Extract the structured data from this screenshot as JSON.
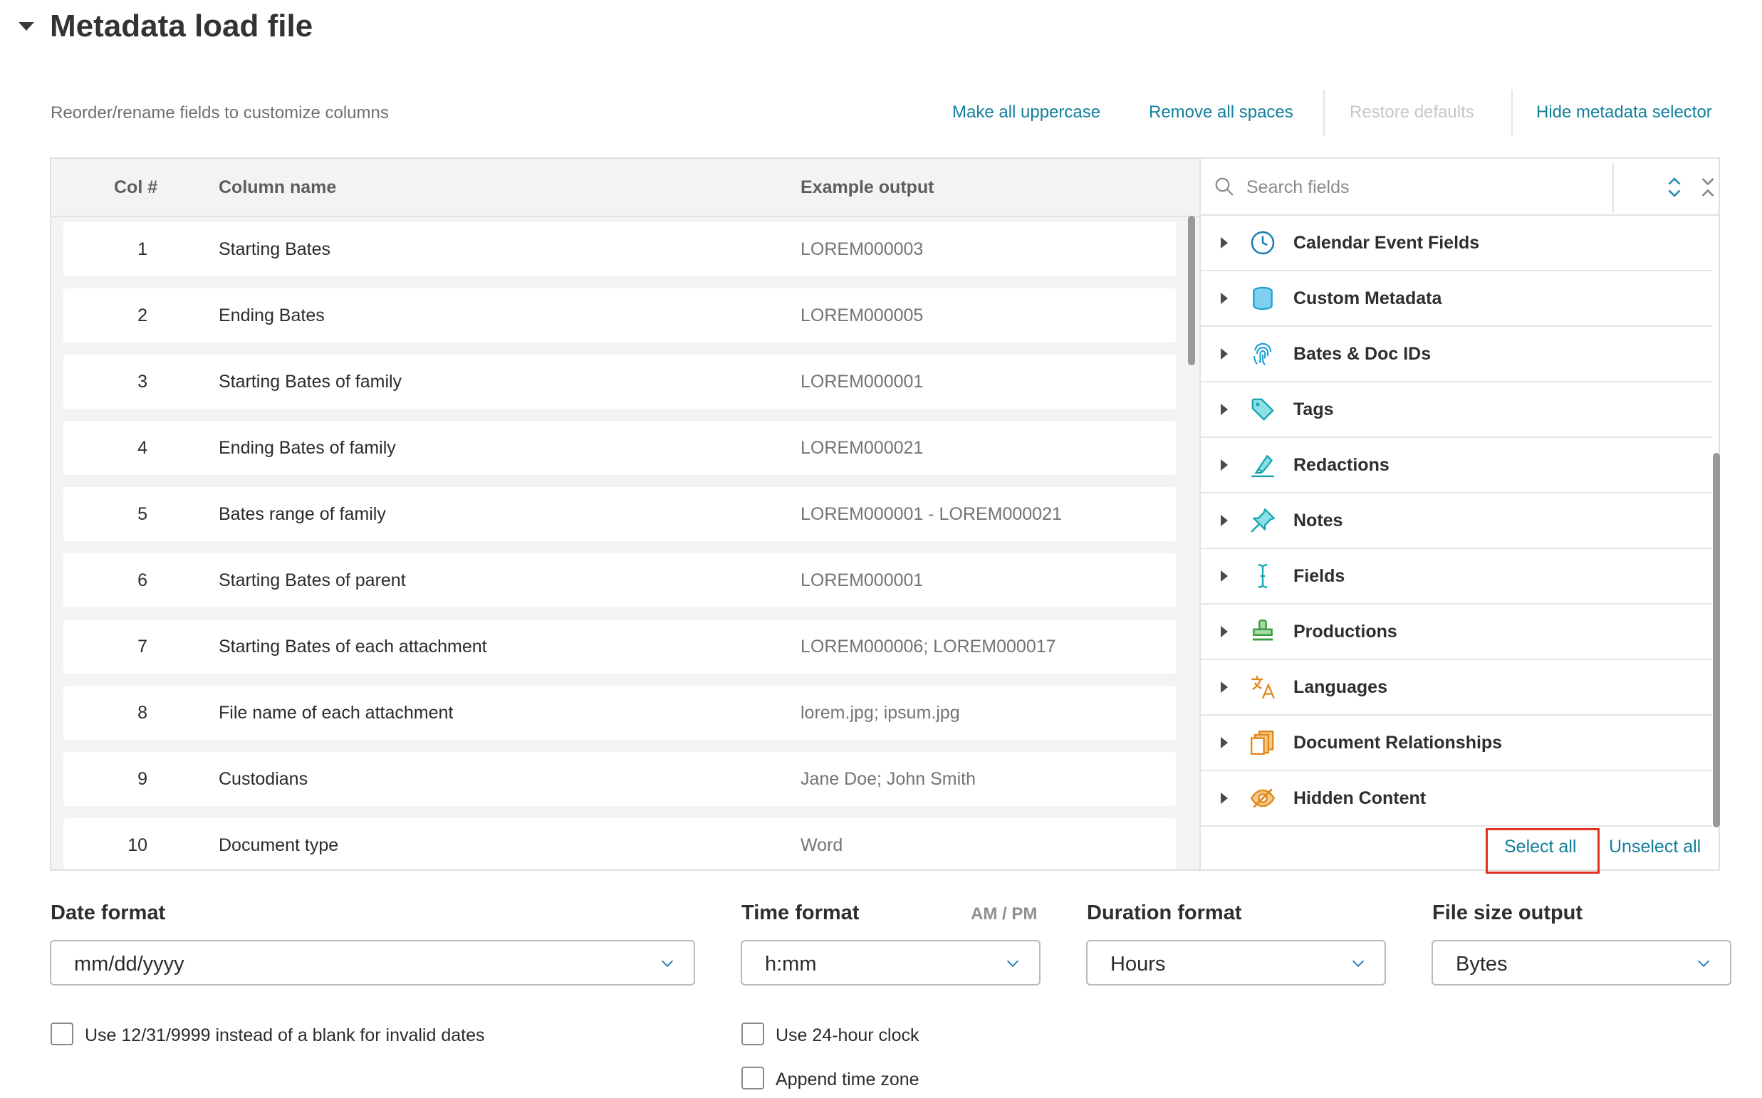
{
  "section": {
    "title": "Metadata load file"
  },
  "subtitle": "Reorder/rename fields to customize columns",
  "toolbar": {
    "uppercase": "Make all uppercase",
    "remove_spaces": "Remove all spaces",
    "restore": "Restore defaults",
    "hide_selector": "Hide metadata selector"
  },
  "table": {
    "headers": {
      "col": "Col #",
      "name": "Column name",
      "example": "Example output"
    },
    "rows": [
      {
        "num": "1",
        "name": "Starting Bates",
        "example": "LOREM000003"
      },
      {
        "num": "2",
        "name": "Ending Bates",
        "example": "LOREM000005"
      },
      {
        "num": "3",
        "name": "Starting Bates of family",
        "example": "LOREM000001"
      },
      {
        "num": "4",
        "name": "Ending Bates of family",
        "example": "LOREM000021"
      },
      {
        "num": "5",
        "name": "Bates range of family",
        "example": "LOREM000001 - LOREM000021"
      },
      {
        "num": "6",
        "name": "Starting Bates of parent",
        "example": "LOREM000001"
      },
      {
        "num": "7",
        "name": "Starting Bates of each attachment",
        "example": "LOREM000006; LOREM000017"
      },
      {
        "num": "8",
        "name": "File name of each attachment",
        "example": "lorem.jpg; ipsum.jpg"
      },
      {
        "num": "9",
        "name": "Custodians",
        "example": "Jane Doe; John Smith"
      },
      {
        "num": "10",
        "name": "Document type",
        "example": "Word"
      }
    ]
  },
  "selector": {
    "search_placeholder": "Search fields",
    "categories": [
      {
        "label": "Calendar Event Fields",
        "icon": "clock-icon",
        "color": "#1b7fb3"
      },
      {
        "label": "Custom Metadata",
        "icon": "database-icon",
        "color": "#21a1d6"
      },
      {
        "label": "Bates & Doc IDs",
        "icon": "fingerprint-icon",
        "color": "#21a1d6"
      },
      {
        "label": "Tags",
        "icon": "tag-icon",
        "color": "#16a6b3"
      },
      {
        "label": "Redactions",
        "icon": "marker-icon",
        "color": "#16a6b3"
      },
      {
        "label": "Notes",
        "icon": "pushpin-icon",
        "color": "#16a6b3"
      },
      {
        "label": "Fields",
        "icon": "text-cursor-icon",
        "color": "#16a6b3"
      },
      {
        "label": "Productions",
        "icon": "stamp-icon",
        "color": "#3a9b3f"
      },
      {
        "label": "Languages",
        "icon": "translate-icon",
        "color": "#e08a1e"
      },
      {
        "label": "Document Relationships",
        "icon": "documents-icon",
        "color": "#e08a1e"
      },
      {
        "label": "Hidden Content",
        "icon": "eye-slash-icon",
        "color": "#e08a1e"
      }
    ],
    "select_all": "Select all",
    "unselect_all": "Unselect all"
  },
  "formats": {
    "date": {
      "label": "Date format",
      "value": "mm/dd/yyyy"
    },
    "time": {
      "label": "Time format",
      "hint": "AM / PM",
      "value": "h:mm"
    },
    "duration": {
      "label": "Duration format",
      "value": "Hours"
    },
    "filesize": {
      "label": "File size output",
      "value": "Bytes"
    }
  },
  "options": {
    "invalid_dates": "Use 12/31/9999 instead of a blank for invalid dates",
    "clock24": "Use 24-hour clock",
    "timezone": "Append time zone"
  },
  "colors": {
    "link": "#127f9a",
    "highlight": "#e03120"
  }
}
